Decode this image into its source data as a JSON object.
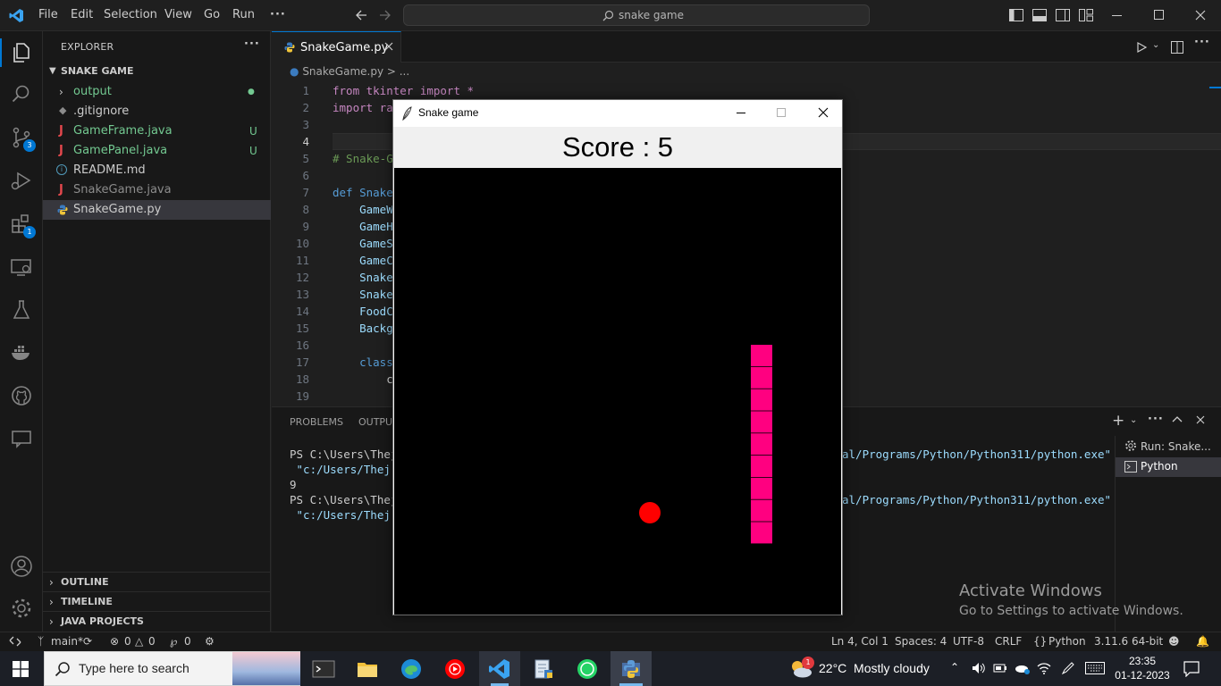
{
  "titlebar": {
    "menu": [
      "File",
      "Edit",
      "Selection",
      "View",
      "Go",
      "Run",
      "···"
    ],
    "search_text": "snake game"
  },
  "activitybar": {
    "source_control_badge": "3",
    "extensions_badge": "1"
  },
  "explorer": {
    "title": "EXPLORER",
    "folder": "SNAKE GAME",
    "items": [
      {
        "label": "output",
        "color": "#73c991",
        "marker": "●"
      },
      {
        "label": ".gitignore",
        "color": "#cccccc",
        "marker": ""
      },
      {
        "label": "GameFrame.java",
        "color": "#73c991",
        "marker": "U"
      },
      {
        "label": "GamePanel.java",
        "color": "#73c991",
        "marker": "U"
      },
      {
        "label": "README.md",
        "color": "#cccccc",
        "marker": ""
      },
      {
        "label": "SnakeGame.java",
        "color": "#8c8c8c",
        "marker": ""
      },
      {
        "label": "SnakeGame.py",
        "color": "#cccccc",
        "marker": ""
      }
    ],
    "sections": [
      "OUTLINE",
      "TIMELINE",
      "JAVA PROJECTS"
    ]
  },
  "editor": {
    "tab_label": "SnakeGame.py",
    "breadcrumb": "SnakeGame.py > ...",
    "lines": [
      {
        "n": "1",
        "text": "from tkinter import *"
      },
      {
        "n": "2",
        "text": "import ra"
      },
      {
        "n": "3",
        "text": ""
      },
      {
        "n": "4",
        "text": ""
      },
      {
        "n": "5",
        "text": "# Snake-G"
      },
      {
        "n": "6",
        "text": ""
      },
      {
        "n": "7",
        "text": "def Snake"
      },
      {
        "n": "8",
        "text": "    GameW"
      },
      {
        "n": "9",
        "text": "    GameH"
      },
      {
        "n": "10",
        "text": "    GameS"
      },
      {
        "n": "11",
        "text": "    GameC"
      },
      {
        "n": "12",
        "text": "    Snake"
      },
      {
        "n": "13",
        "text": "    Snake"
      },
      {
        "n": "14",
        "text": "    FoodC"
      },
      {
        "n": "15",
        "text": "    Backg"
      },
      {
        "n": "16",
        "text": ""
      },
      {
        "n": "17",
        "text": "    class"
      },
      {
        "n": "18",
        "text": "        c"
      },
      {
        "n": "19",
        "text": ""
      }
    ]
  },
  "panel": {
    "tabs": [
      "PROBLEMS",
      "OUTPUT"
    ],
    "terminal_lines": [
      {
        "left": "PS C:\\Users\\Thej",
        "right": "al/Programs/Python/Python311/python.exe\""
      },
      {
        "left": " \"c:/Users/Thej V",
        "right": ""
      },
      {
        "left": "9",
        "right": ""
      },
      {
        "left": "PS C:\\Users\\Thej",
        "right": "al/Programs/Python/Python311/python.exe\""
      },
      {
        "left": " \"c:/Users/Thej V",
        "right": ""
      }
    ],
    "terminals": [
      "Run: Snake...",
      "Python"
    ]
  },
  "statusbar": {
    "branch": "main*",
    "errors": "0",
    "warnings": "0",
    "ports": "0",
    "position": "Ln 4, Col 1",
    "spaces": "Spaces: 4",
    "encoding": "UTF-8",
    "eol": "CRLF",
    "language": "Python",
    "interpreter": "3.11.6 64-bit"
  },
  "game": {
    "window_title": "Snake game",
    "score_text": "Score : 5",
    "snake_color": "#ff0080",
    "food_color": "#ff0000"
  },
  "watermark": {
    "title": "Activate Windows",
    "subtitle": "Go to Settings to activate Windows."
  },
  "taskbar": {
    "search_placeholder": "Type here to search",
    "weather": "22°C  Mostly cloudy",
    "weather_badge": "1",
    "time": "23:35",
    "date": "01-12-2023"
  }
}
